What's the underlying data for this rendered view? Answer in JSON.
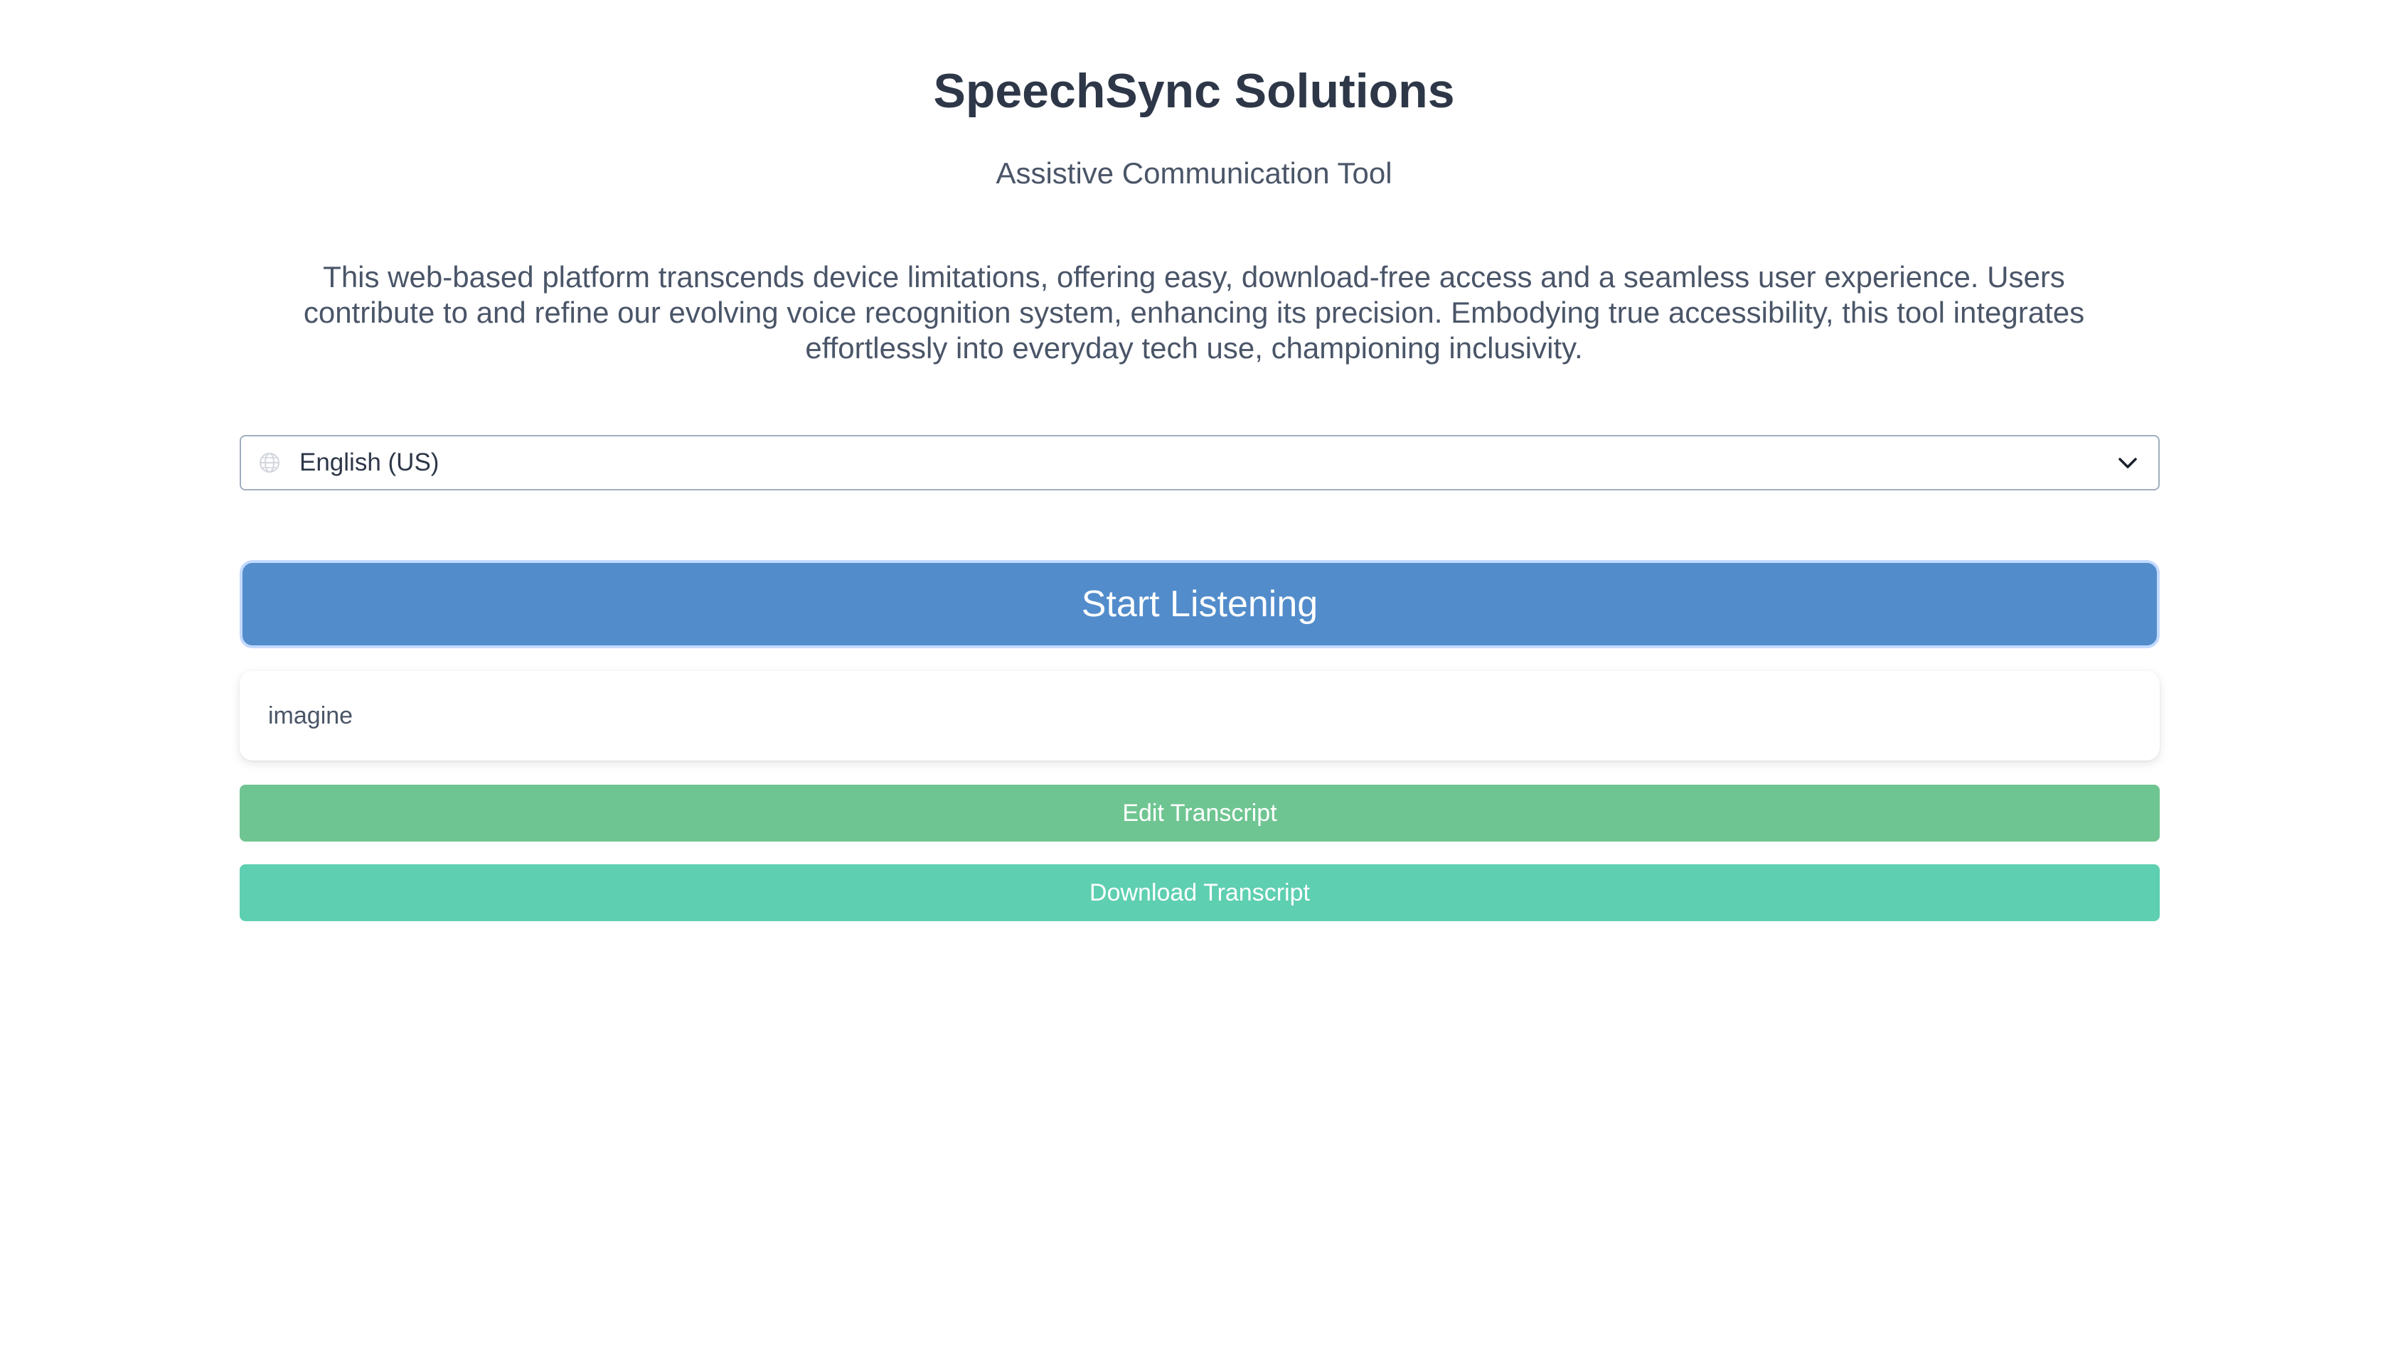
{
  "app": {
    "title": "SpeechSync Solutions",
    "subtitle": "Assistive Communication Tool",
    "description": "This web-based platform transcends device limitations, offering easy, download-free access and a seamless user experience. Users contribute to and refine our evolving voice recognition system, enhancing its precision. Embodying true accessibility, this tool integrates effortlessly into everyday tech use, championing inclusivity."
  },
  "language_select": {
    "selected": "English (US)",
    "icon": "globe-icon",
    "dropdown_icon": "chevron-down-icon"
  },
  "controls": {
    "start_label": "Start Listening",
    "edit_label": "Edit Transcript",
    "download_label": "Download Transcript"
  },
  "transcript": {
    "text": "imagine"
  },
  "colors": {
    "start_button": "#528ccb",
    "edit_button": "#6fc591",
    "download_button": "#5ecfb1",
    "text_dark": "#2d3748"
  }
}
